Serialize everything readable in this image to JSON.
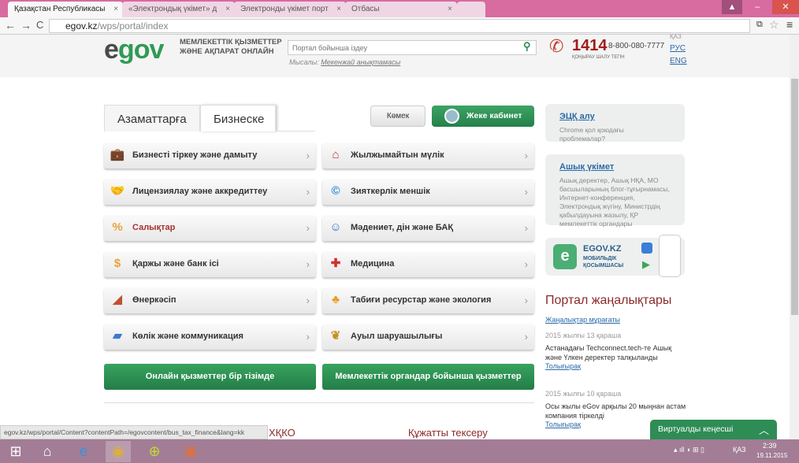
{
  "browser": {
    "tabs": [
      "Қазақстан Республикасы",
      "«Электрондық үкімет» д",
      "Электронды үкімет порт",
      "Отбасы"
    ],
    "url_host": "egov.kz",
    "url_path": "/wps/portal/index"
  },
  "header": {
    "logo": "egov",
    "slogan_1": "МЕМЛЕКЕТТІК ҚЫЗМЕТТЕР",
    "slogan_2": "ЖӘНЕ АҚПАРАТ ОНЛАЙН",
    "search_placeholder": "Портал бойынша іздеу",
    "example_label": "Мысалы:",
    "example_link": "Мекенжай анықтамасы",
    "phone_short": "1414",
    "phone_long": "8-800-080-7777",
    "call_free": "ҚОҢЫРАУ ШАЛУ ТЕГІН",
    "languages": [
      "ҚАЗ",
      "РУС",
      "ENG"
    ]
  },
  "tabs": [
    "Азаматтарға",
    "Бизнеске"
  ],
  "help_button": "Көмек",
  "cabinet_button": "Жеке кабинет",
  "menu": {
    "left": [
      {
        "label": "Бизнесті тіркеу және дамыту",
        "icon": "briefcase-icon"
      },
      {
        "label": "Лицензиялау және аккредиттеу",
        "icon": "handshake-icon"
      },
      {
        "label": "Салықтар",
        "icon": "percent-icon"
      },
      {
        "label": "Қаржы және банк ісі",
        "icon": "coin-icon"
      },
      {
        "label": "Өнеркәсіп",
        "icon": "trowel-icon"
      },
      {
        "label": "Көлік және коммуникация",
        "icon": "truck-icon"
      }
    ],
    "right": [
      {
        "label": "Жылжымайтын мүлік",
        "icon": "house-icon"
      },
      {
        "label": "Зияткерлік меншік",
        "icon": "copyright-icon"
      },
      {
        "label": "Мәдениет, дін және БАҚ",
        "icon": "theater-masks-icon"
      },
      {
        "label": "Медицина",
        "icon": "first-aid-icon"
      },
      {
        "label": "Табиғи ресурстар және экология",
        "icon": "tree-icon"
      },
      {
        "label": "Ауыл шаруашылығы",
        "icon": "wheat-icon"
      }
    ]
  },
  "green_buttons": [
    "Онлайн қызметтер бір тізімде",
    "Мемлекеттік органдар бойынша қызметтер"
  ],
  "sidebar": {
    "box1_title": "ЭЦҚ алу",
    "box1_text": "Chrome қол қоюдағы проблемалар?",
    "box2_title": "Ашық үкімет",
    "box2_text": "Ашық деректер, Ашық НҚА, МО басшыларының блог-тұғырнамасы, Интернет-конференция, Электрондық жүгіну, Министрдің қабылдауына жазылу, ҚР мемлекеттік органдары",
    "app_title": "EGOV.KZ",
    "app_sub_1": "МОБИЛЬДІК",
    "app_sub_2": "ҚОСЫМШАСЫ"
  },
  "news": {
    "heading": "Портал жаңалықтары",
    "archive": "Жаңалықтар мұрағаты",
    "items": [
      {
        "date": "2015 жылғы 13 қараша",
        "text": "Астанадағы Techconnect.tech-те Ашық және Үлкен деректер талқыланды",
        "more": "Толығырақ"
      },
      {
        "date": "2015 жылғы 10 қараша",
        "text": "Осы жылы eGov арқылы 20 мыңнан астам компания тіркелді",
        "more": "Толығырақ"
      }
    ]
  },
  "sections": [
    "ХҚКО",
    "Құжатты тексеру"
  ],
  "status_url": "egov.kz/wps/portal/Content?contentPath=/egovcontent/bus_tax_finance&lang=kk",
  "virtual_assistant": "Виртуалды кеңесші",
  "tray": {
    "lang": "ҚАЗ",
    "time": "2:39",
    "date": "19.11.2015"
  },
  "colors": {
    "brand_green": "#2f9a55",
    "titlebar": "#d86ba0",
    "taskbar": "#a27d95",
    "news_heading": "#8b2a2a"
  }
}
